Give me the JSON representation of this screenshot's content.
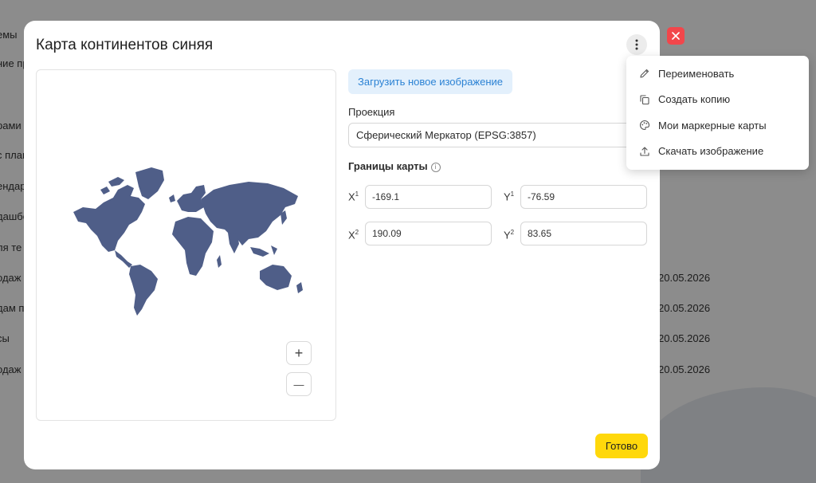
{
  "background": {
    "menu_items": [
      "емы",
      "ние пр",
      "рами",
      "с план",
      "ендар",
      "дашбо",
      "ля те",
      "одаж",
      "дам п",
      "сы",
      "одаж"
    ],
    "dates": [
      "20.05.2026",
      "20.05.2026",
      "20.05.2026",
      "20.05.2026"
    ]
  },
  "modal": {
    "title": "Карта континентов синяя",
    "upload_label": "Загрузить новое изображение",
    "projection_label": "Проекция",
    "projection_value": "Сферический Меркатор (EPSG:3857)",
    "bounds_label": "Границы карты",
    "info_glyph": "i",
    "x1_label": "X",
    "x1_sup": "1",
    "y1_label": "Y",
    "y1_sup": "1",
    "x2_label": "X",
    "x2_sup": "2",
    "y2_label": "Y",
    "y2_sup": "2",
    "x1_value": "-169.1",
    "y1_value": "-76.59",
    "x2_value": "190.09",
    "y2_value": "83.65",
    "zoom_in": "+",
    "zoom_out": "—",
    "done_label": "Готово",
    "map_color": "#4f5e88"
  },
  "menu": {
    "items": [
      {
        "label": "Переименовать",
        "icon": "pencil-icon"
      },
      {
        "label": "Создать копию",
        "icon": "copy-icon"
      },
      {
        "label": "Мои маркерные карты",
        "icon": "palette-icon"
      },
      {
        "label": "Скачать изображение",
        "icon": "upload-icon"
      }
    ]
  },
  "colors": {
    "close": "#f2464b",
    "upload_bg": "#e3f0fc",
    "upload_text": "#2b82d4",
    "done_bg": "#ffd80b"
  }
}
